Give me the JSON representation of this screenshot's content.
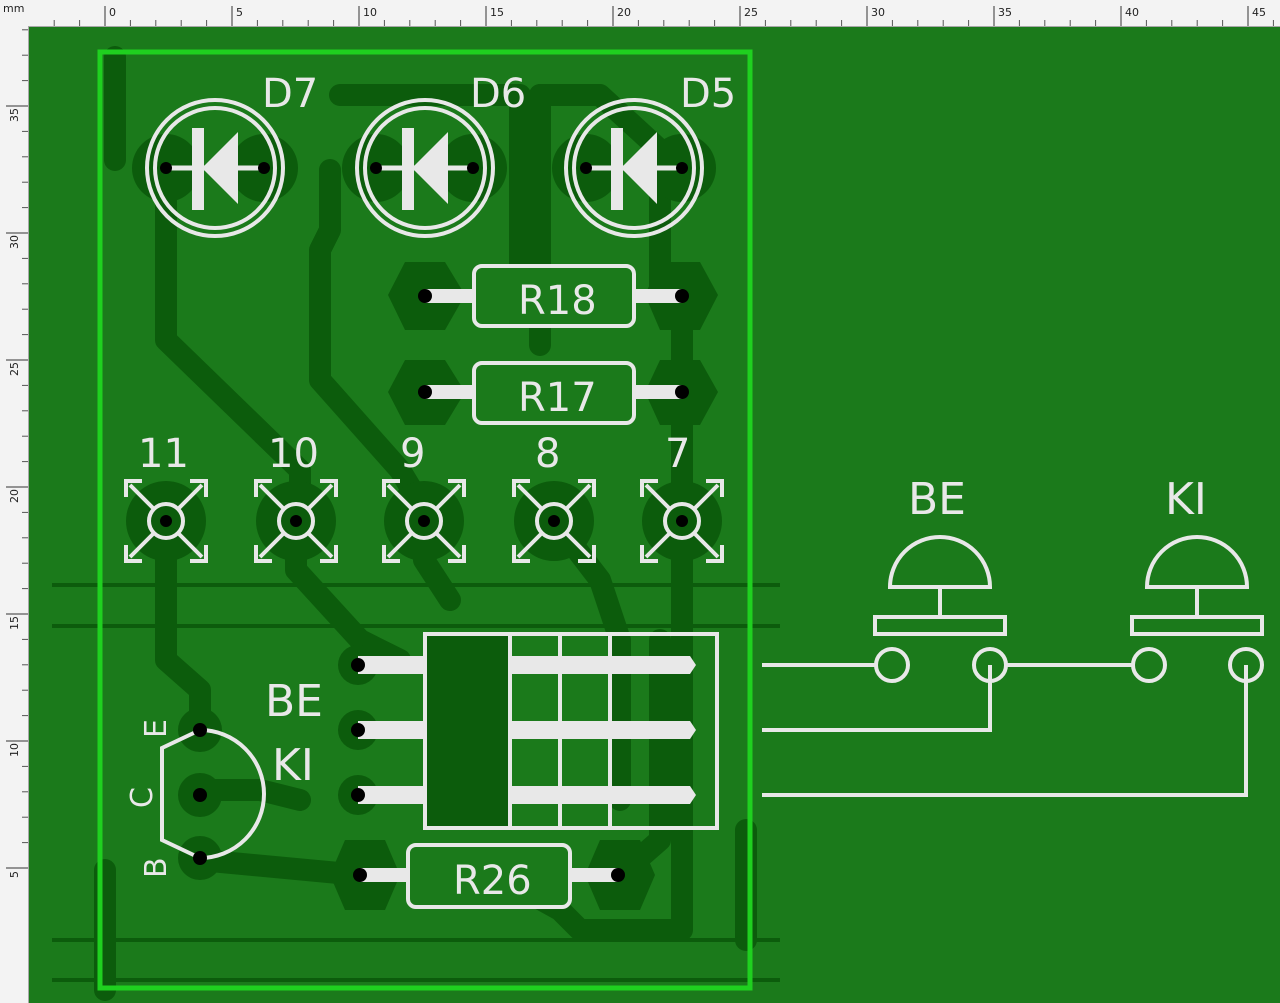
{
  "ruler": {
    "unit": "mm",
    "h_ticks": [
      "0",
      "5",
      "10",
      "15",
      "20",
      "25",
      "30",
      "35",
      "40",
      "45"
    ],
    "v_ticks": [
      "35",
      "30",
      "25",
      "20",
      "15",
      "10",
      "5"
    ]
  },
  "board": {
    "leds": [
      "D7",
      "D6",
      "D5"
    ],
    "resistors": [
      "R18",
      "R17",
      "R26"
    ],
    "pads": [
      "11",
      "10",
      "9",
      "8",
      "7"
    ],
    "transistor_pins": [
      "E",
      "C",
      "B"
    ],
    "labels": [
      "BE",
      "KI"
    ],
    "buttons": [
      "BE",
      "KI"
    ]
  },
  "colors": {
    "board": "#1b7a1b",
    "trace": "#0c5c0c",
    "silkscreen": "#e8e8e8",
    "outline": "#1fd01f",
    "ruler_bg": "#f3f3f3"
  }
}
